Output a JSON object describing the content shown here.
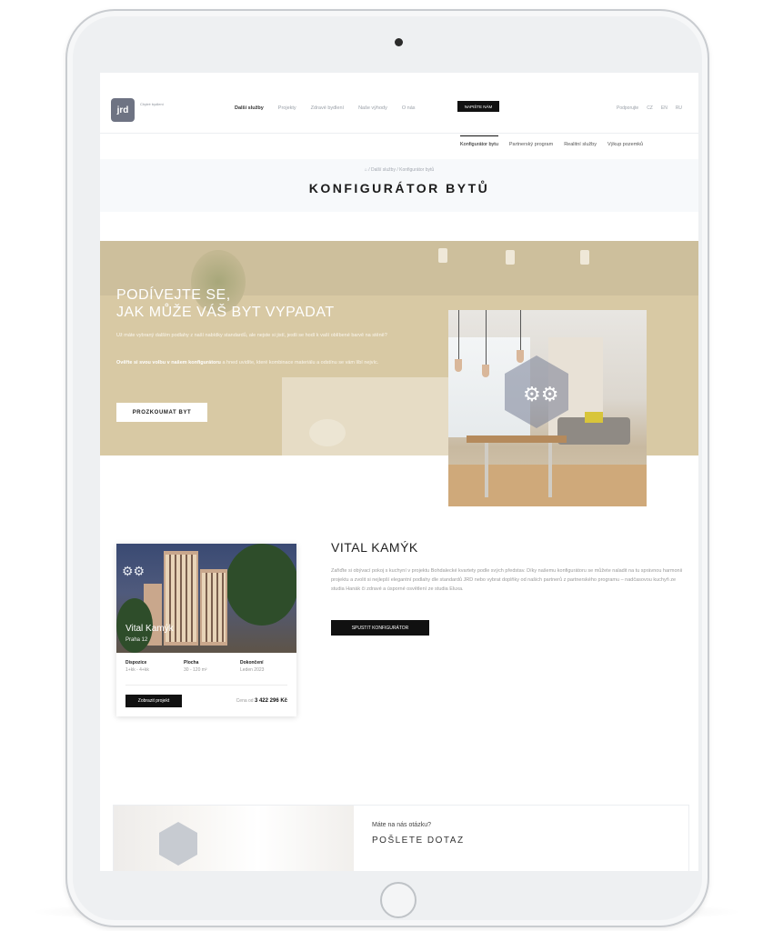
{
  "header": {
    "logo_text": "jrd",
    "logo_sub": "Chytré bydlení",
    "nav": [
      "Další služby",
      "Projekty",
      "Zdravé bydlení",
      "Naše výhody",
      "O nás"
    ],
    "cta": "NAPIŠTE NÁM",
    "langs": [
      "Podporujte",
      "CZ",
      "EN",
      "RU"
    ]
  },
  "subnav": [
    "Konfigurátor bytu",
    "Partnerský program",
    "Realitní služby",
    "Výkup pozemků"
  ],
  "breadcrumb": "⌂ / Další služby / Konfigurátor bytů",
  "page_title": "KONFIGURÁTOR BYTŮ",
  "hero": {
    "heading_line1": "PODÍVEJTE SE,",
    "heading_line2": "JAK MŮŽE VÁŠ BYT VYPADAT",
    "text1": "Už máte vybraný dalším podlahy z naší nabídky standardů, ale nejste si jistí, jestli se hodí k vaší oblíbené barvě na stěně?",
    "text2_bold": "Ověřte si svou volbu v našem konfigurátoru",
    "text2_rest": " a hned uvidíte, které kombinace materiálu a odstínu se vám líbí nejvíc.",
    "button": "PROZKOUMAT BYT"
  },
  "project": {
    "name": "Vital Kamýk",
    "location": "Praha 12",
    "specs": [
      {
        "label": "Dispozice",
        "value": "1+kk - 4+kk"
      },
      {
        "label": "Plocha",
        "value": "30 - 120 m²"
      },
      {
        "label": "Dokončení",
        "value": "Leden 2023"
      }
    ],
    "show_button": "Zobrazit projekt",
    "price_label": "Cena od",
    "price": "3 422 296 Kč",
    "title": "VITAL KAMÝK",
    "description": "Zařiďte si obývací pokoj s kuchyní v projektu Bohdalecké kvartety podle svých představ. Díky našemu konfigurátoru se můžete naladit na tu správnou harmonii projektu a zvolit si nejlepší elegantní podlahy dle standardů JRD nebo vybrat doplňky od našich partnerů z partnerského programu – nadčasovou kuchyň ze studia Hanák či zdravé a úsporné osvětlení ze studia Eluxa.",
    "config_button": "SPUSTIT KONFIGURÁTOR"
  },
  "bottom": {
    "question": "Máte na nás otázku?",
    "cta": "POŠLETE DOTAZ"
  }
}
